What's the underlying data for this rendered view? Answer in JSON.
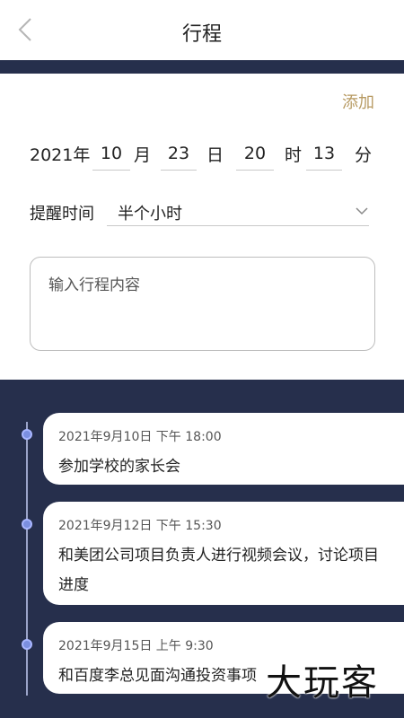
{
  "header": {
    "title": "行程",
    "back_icon": "chevron-left-icon"
  },
  "form": {
    "add_label": "添加",
    "date": {
      "year_label": "2021年",
      "month": "10",
      "month_unit": "月",
      "day": "23",
      "day_unit": "日",
      "hour": "20",
      "hour_unit": "时",
      "minute": "13",
      "minute_unit": "分"
    },
    "reminder": {
      "label": "提醒时间",
      "value": "半个小时",
      "icon": "chevron-down-icon"
    },
    "content": {
      "placeholder": "输入行程内容"
    }
  },
  "schedule": [
    {
      "time": "2021年9月10日  下午 18:00",
      "text": "参加学校的家长会"
    },
    {
      "time": "2021年9月12日  下午 15:30",
      "text": "和美团公司项目负责人进行视频会议，讨论项目进度"
    },
    {
      "time": "2021年9月15日  上午 9:30",
      "text": "和百度李总见面沟通投资事项"
    }
  ],
  "watermark": "大玩客",
  "colors": {
    "navy": "#262f4c",
    "accent": "#b79a62",
    "dot": "#7b8fe0"
  }
}
